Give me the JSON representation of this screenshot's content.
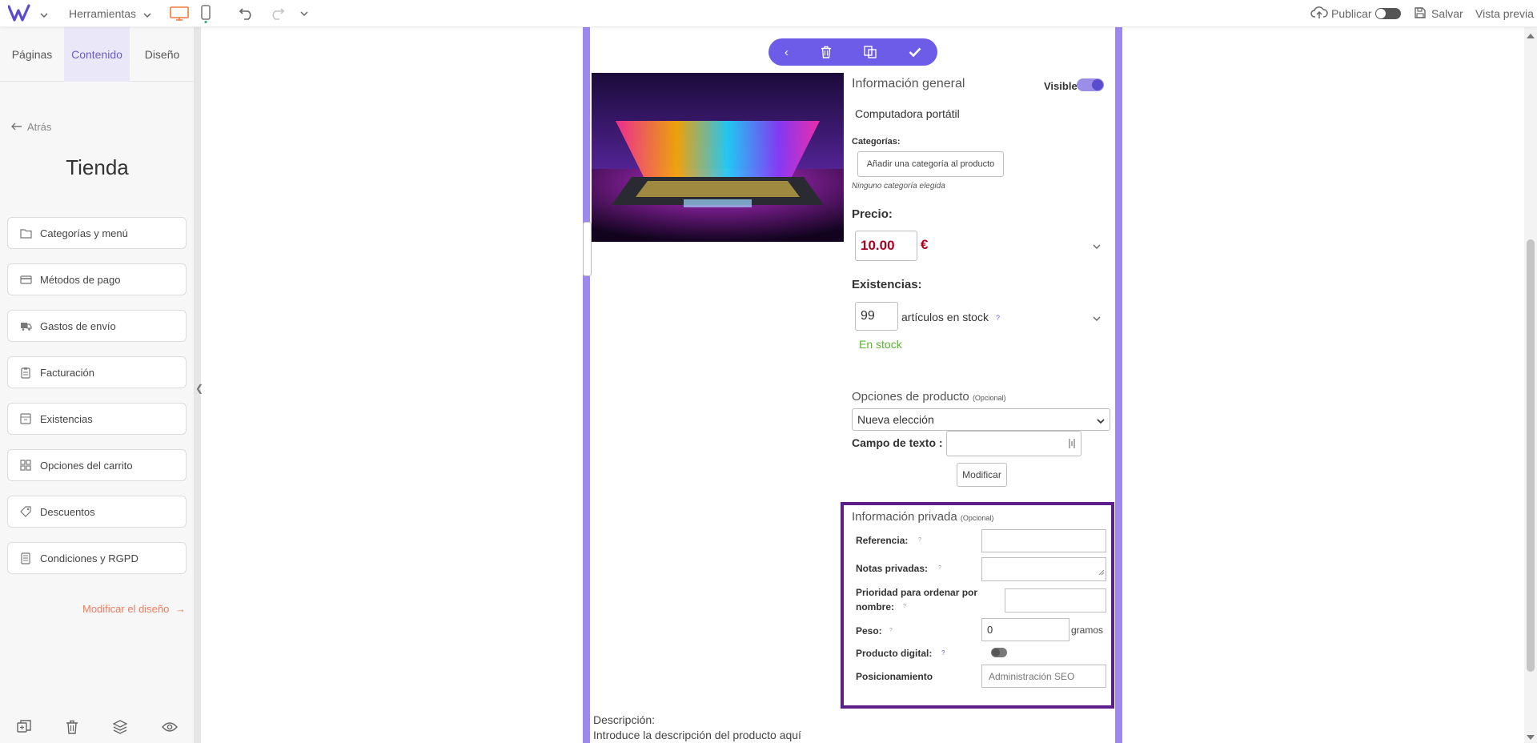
{
  "topbar": {
    "tools_label": "Herramientas",
    "publish_label": "Publicar",
    "save_label": "Salvar",
    "preview_label": "Vista previa"
  },
  "sidebar": {
    "tabs": [
      {
        "label": "Páginas"
      },
      {
        "label": "Contenido"
      },
      {
        "label": "Diseño"
      }
    ],
    "back_label": "Atrás",
    "title": "Tienda",
    "items": [
      {
        "label": "Categorías y menú",
        "icon": "folder-icon"
      },
      {
        "label": "Métodos de pago",
        "icon": "credit-card-icon"
      },
      {
        "label": "Gastos de envío",
        "icon": "truck-icon"
      },
      {
        "label": "Facturación",
        "icon": "clipboard-icon"
      },
      {
        "label": "Existencias",
        "icon": "box-icon"
      },
      {
        "label": "Opciones del carrito",
        "icon": "grid-icon"
      },
      {
        "label": "Descuentos",
        "icon": "tag-icon"
      },
      {
        "label": "Condiciones y RGPD",
        "icon": "document-icon"
      }
    ],
    "modify_design_label": "Modificar el diseño"
  },
  "product": {
    "general_info_label": "Información general",
    "visible_label": "Visible",
    "visible_on": true,
    "name": "Computadora portátil",
    "categories_label": "Categorías:",
    "add_category_button": "Añadir una categoría al producto",
    "no_category_text": "Ninguno categoría elegida",
    "price_label": "Precio:",
    "price_value": "10.00",
    "currency": "€",
    "stock_label": "Existencias:",
    "stock_value": "99",
    "stock_unit": "artículos en stock",
    "help_mark": "?",
    "in_stock_text": "En stock",
    "options_label": "Opciones de producto",
    "optional_label": "(Opcional)",
    "options_select_value": "Nueva elección",
    "text_field_label": "Campo de texto :",
    "modify_button": "Modificar",
    "private_info_label": "Información privada",
    "reference_label": "Referencia:",
    "private_notes_label": "Notas privadas:",
    "priority_label_line1": "Prioridad para ordenar por",
    "priority_label_line2": "nombre:",
    "weight_label": "Peso:",
    "weight_value": "0",
    "weight_unit": "gramos",
    "digital_label": "Producto digital:",
    "digital_on": false,
    "seo_label": "Posicionamiento",
    "seo_button": "Administración SEO",
    "description_label": "Descripción:",
    "description_placeholder": "Introduce la descripción del producto aquí"
  },
  "colors": {
    "accent": "#6c5ce7",
    "frame": "#9c88ef",
    "price_red": "#b00020",
    "in_stock_green": "#58b431",
    "modify_link": "#f07a5e",
    "private_border": "#5b1e8a"
  }
}
